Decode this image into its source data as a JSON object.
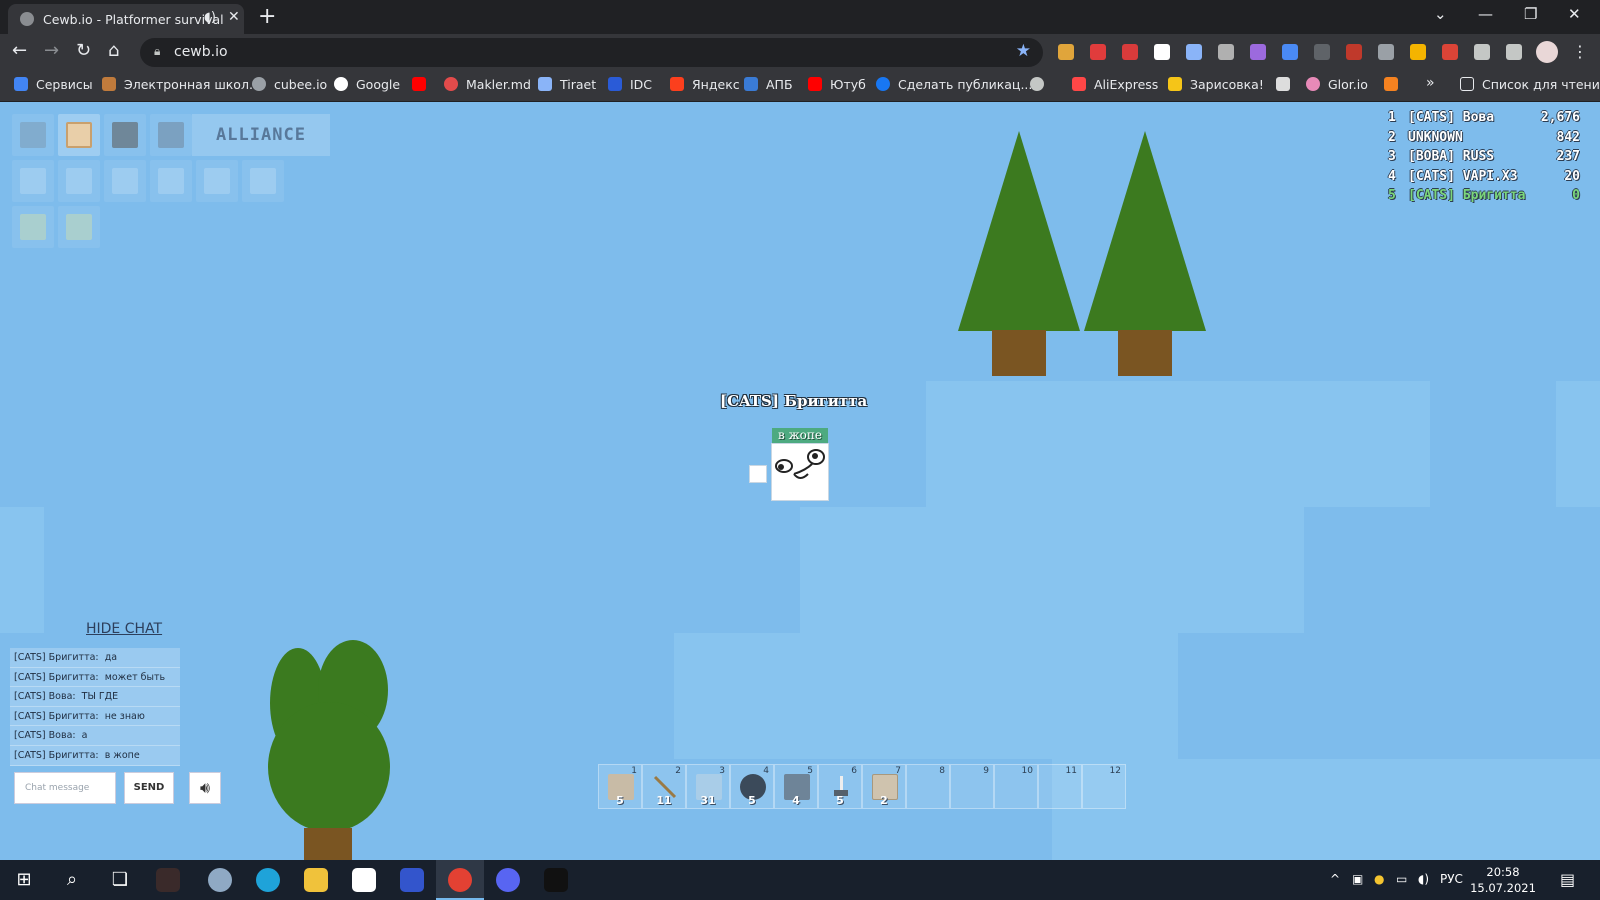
{
  "browser": {
    "tab_title": "Cewb.io - Platformer survival",
    "new_tab": "+",
    "url": "cewb.io",
    "bookmarks": [
      {
        "label": "Сервисы",
        "color": "#4285f4"
      },
      {
        "label": "Электронная школ...",
        "color": "#c07b3c"
      },
      {
        "label": "cubee.io",
        "color": "#9aa0a6"
      },
      {
        "label": "Google",
        "color": "#ffffff"
      },
      {
        "label": "",
        "color": "#ff0000"
      },
      {
        "label": "Makler.md",
        "color": "#e34b4b"
      },
      {
        "label": "Tiraet",
        "color": "#8ab4f8"
      },
      {
        "label": "IDC",
        "color": "#2a5bd7"
      },
      {
        "label": "Яндекс",
        "color": "#fc3f1d"
      },
      {
        "label": "АПБ",
        "color": "#3a7bd5"
      },
      {
        "label": "Ютуб",
        "color": "#ff0000"
      },
      {
        "label": "Сделать публикац...",
        "color": "#1877f2"
      },
      {
        "label": "",
        "color": "#c4c7c5"
      },
      {
        "label": "AliExpress",
        "color": "#ff4747"
      },
      {
        "label": "Зарисовка!",
        "color": "#f5c518"
      },
      {
        "label": "",
        "color": "#dddddd"
      },
      {
        "label": "Glor.io",
        "color": "#e88ab8"
      },
      {
        "label": "",
        "color": "#f58220"
      }
    ],
    "more_label": "»",
    "reading_list": "Список для чтения"
  },
  "game": {
    "alliance_label": "ALLIANCE",
    "leaderboard": [
      {
        "rank": "1",
        "name": "[CATS] Вова",
        "score": "2,676"
      },
      {
        "rank": "2",
        "name": "UNKNOWN",
        "score": "842"
      },
      {
        "rank": "3",
        "name": "[BOBA] RUSS",
        "score": "237"
      },
      {
        "rank": "4",
        "name": "[CATS] VAPI.X3",
        "score": "20"
      },
      {
        "rank": "5",
        "name": "[CATS] Бригитта",
        "score": "0"
      }
    ],
    "player": {
      "name": "[CATS] Бригитта",
      "bubble": "в жопе"
    },
    "chat": {
      "hide_label": "HIDE CHAT",
      "messages": [
        {
          "author": "[CATS] Бригитта:",
          "text": "да"
        },
        {
          "author": "[CATS] Бригитта:",
          "text": "может быть"
        },
        {
          "author": "[CATS] Вова:",
          "text": "ТЫ ГДЕ"
        },
        {
          "author": "[CATS] Бригитта:",
          "text": "не знаю"
        },
        {
          "author": "[CATS] Вова:",
          "text": "а"
        },
        {
          "author": "[CATS] Бригитта:",
          "text": "в жопе"
        }
      ],
      "placeholder": "Chat message",
      "send_label": "SEND"
    },
    "hotbar": [
      {
        "n": "1",
        "count": "5",
        "icon": "stone-block",
        "color": "#c8bba6"
      },
      {
        "n": "2",
        "count": "11",
        "icon": "stick",
        "color": "#9a7a45"
      },
      {
        "n": "3",
        "count": "31",
        "icon": "glass-block",
        "color": "#a9cde8"
      },
      {
        "n": "4",
        "count": "5",
        "icon": "coal",
        "color": "#3b4a5a"
      },
      {
        "n": "5",
        "count": "4",
        "icon": "stone-slab",
        "color": "#6e8498"
      },
      {
        "n": "6",
        "count": "5",
        "icon": "hammer",
        "color": "#55606b"
      },
      {
        "n": "7",
        "count": "2",
        "icon": "planks",
        "color": "#cfc3ae"
      },
      {
        "n": "8",
        "count": "",
        "icon": "",
        "color": ""
      },
      {
        "n": "9",
        "count": "",
        "icon": "",
        "color": ""
      },
      {
        "n": "10",
        "count": "",
        "icon": "",
        "color": ""
      },
      {
        "n": "11",
        "count": "",
        "icon": "",
        "color": ""
      },
      {
        "n": "12",
        "count": "",
        "icon": "",
        "color": ""
      }
    ]
  },
  "taskbar": {
    "lang": "РУС",
    "time": "20:58",
    "date": "15.07.2021"
  }
}
